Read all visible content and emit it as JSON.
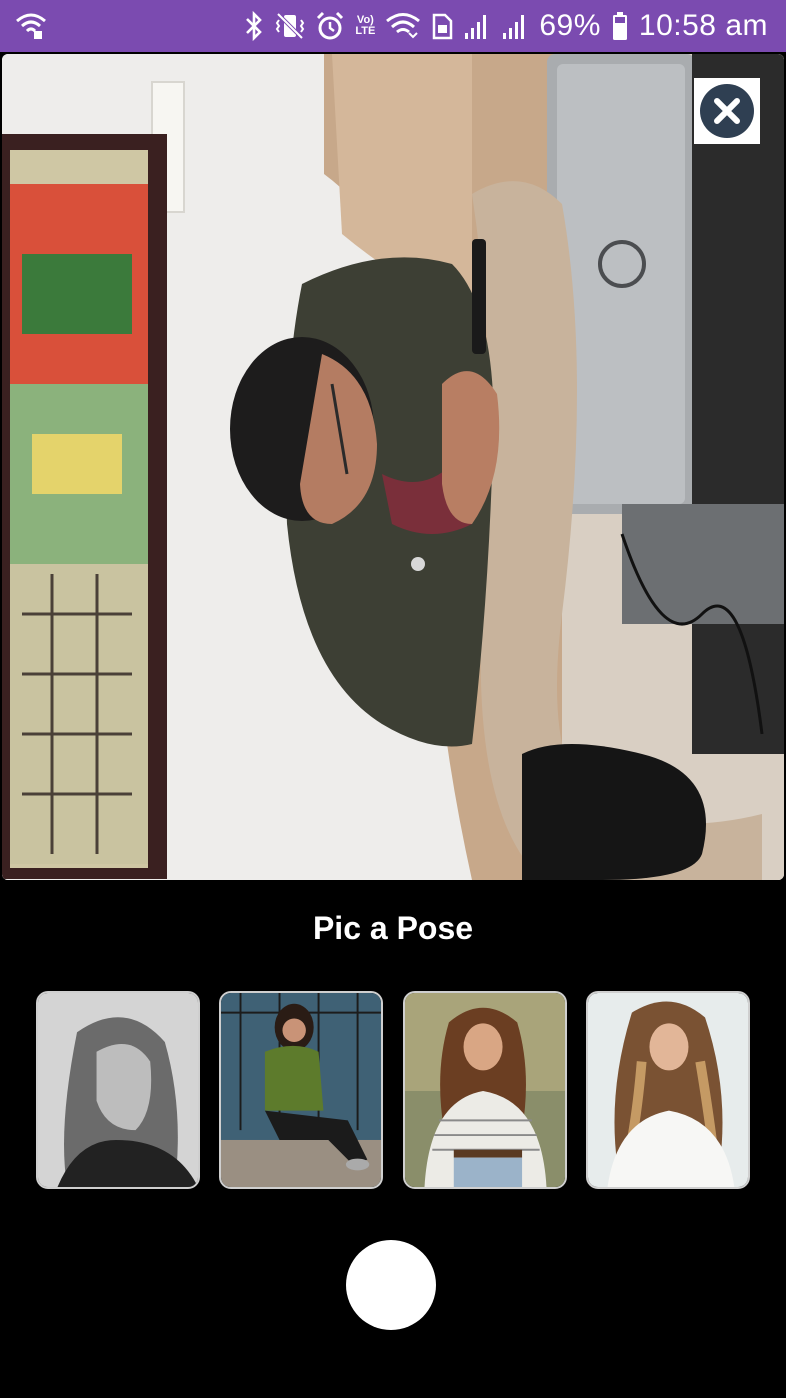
{
  "status_bar": {
    "battery_percent": "69%",
    "time": "10:58 am",
    "volte_top": "Vo)",
    "volte_bottom": "LTE",
    "icons": [
      "wifi-calling-icon",
      "bluetooth-icon",
      "vibrate-icon",
      "alarm-icon",
      "volte-icon",
      "wifi-icon",
      "sim-icon",
      "signal-icon",
      "signal-icon",
      "battery-icon"
    ],
    "background_color": "#7b4bb0"
  },
  "camera_preview": {
    "close_icon": "close-circle-icon"
  },
  "pose_picker": {
    "title": "Pic a Pose",
    "poses": [
      {
        "name": "pose-1",
        "style": "grayscale-portrait"
      },
      {
        "name": "pose-2",
        "style": "sitting-green-shirt"
      },
      {
        "name": "pose-3",
        "style": "striped-shirt-smile"
      },
      {
        "name": "pose-4",
        "style": "long-hair-white-top"
      }
    ]
  },
  "controls": {
    "shutter_icon": "shutter-button"
  }
}
